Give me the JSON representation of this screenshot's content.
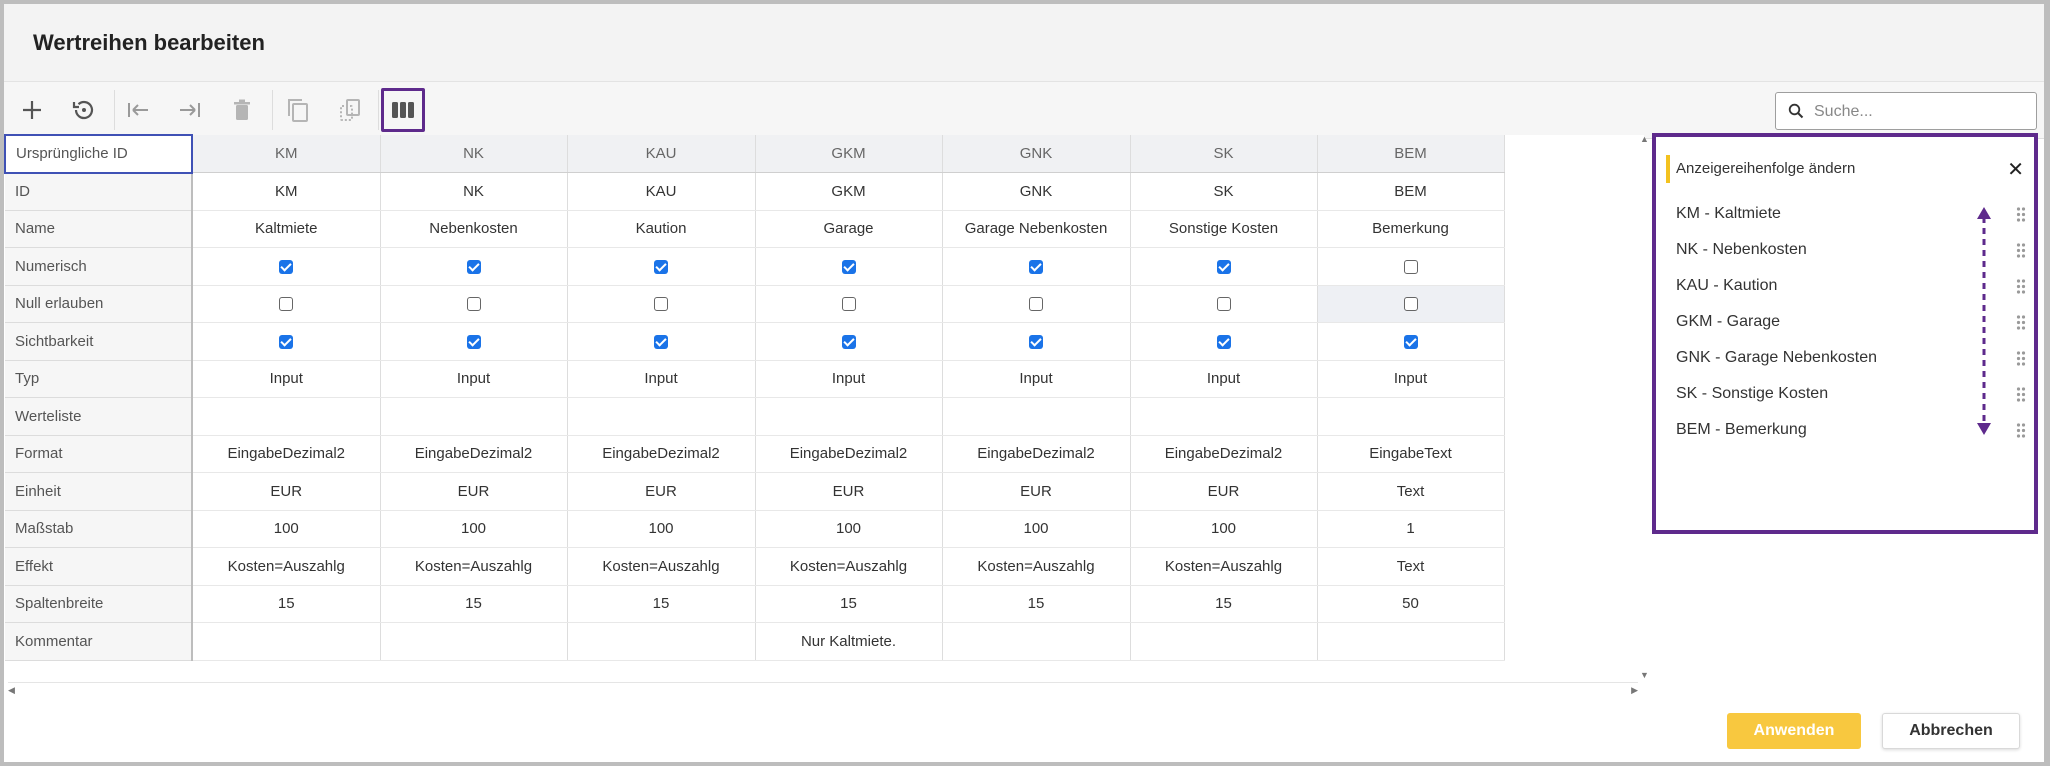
{
  "dialog": {
    "title": "Wertreihen bearbeiten"
  },
  "toolbar": {
    "search_placeholder": "Suche...",
    "icons": [
      "plus-icon",
      "history-icon",
      "move-first-icon",
      "move-last-icon",
      "delete-icon",
      "copy-icon",
      "paste-icon",
      "columns-icon"
    ]
  },
  "grid": {
    "corner_label": "Ursprüngliche ID",
    "columns": [
      "KM",
      "NK",
      "KAU",
      "GKM",
      "GNK",
      "SK",
      "BEM"
    ],
    "rows": [
      {
        "label": "ID",
        "type": "text",
        "values": [
          "KM",
          "NK",
          "KAU",
          "GKM",
          "GNK",
          "SK",
          "BEM"
        ]
      },
      {
        "label": "Name",
        "type": "text",
        "values": [
          "Kaltmiete",
          "Nebenkosten",
          "Kaution",
          "Garage",
          "Garage Nebenkosten",
          "Sonstige Kosten",
          "Bemerkung"
        ]
      },
      {
        "label": "Numerisch",
        "type": "checkbox",
        "values": [
          true,
          true,
          true,
          true,
          true,
          true,
          false
        ]
      },
      {
        "label": "Null erlauben",
        "type": "checkbox",
        "values": [
          false,
          false,
          false,
          false,
          false,
          false,
          false
        ]
      },
      {
        "label": "Sichtbarkeit",
        "type": "checkbox",
        "values": [
          true,
          true,
          true,
          true,
          true,
          true,
          true
        ]
      },
      {
        "label": "Typ",
        "type": "text",
        "values": [
          "Input",
          "Input",
          "Input",
          "Input",
          "Input",
          "Input",
          "Input"
        ]
      },
      {
        "label": "Werteliste",
        "type": "text",
        "values": [
          "",
          "",
          "",
          "",
          "",
          "",
          ""
        ]
      },
      {
        "label": "Format",
        "type": "text",
        "values": [
          "EingabeDezimal2",
          "EingabeDezimal2",
          "EingabeDezimal2",
          "EingabeDezimal2",
          "EingabeDezimal2",
          "EingabeDezimal2",
          "EingabeText"
        ]
      },
      {
        "label": "Einheit",
        "type": "text",
        "values": [
          "EUR",
          "EUR",
          "EUR",
          "EUR",
          "EUR",
          "EUR",
          "Text"
        ]
      },
      {
        "label": "Maßstab",
        "type": "text",
        "values": [
          "100",
          "100",
          "100",
          "100",
          "100",
          "100",
          "1"
        ]
      },
      {
        "label": "Effekt",
        "type": "text",
        "values": [
          "Kosten=Auszahlg",
          "Kosten=Auszahlg",
          "Kosten=Auszahlg",
          "Kosten=Auszahlg",
          "Kosten=Auszahlg",
          "Kosten=Auszahlg",
          "Text"
        ]
      },
      {
        "label": "Spaltenbreite",
        "type": "text",
        "values": [
          "15",
          "15",
          "15",
          "15",
          "15",
          "15",
          "50"
        ]
      },
      {
        "label": "Kommentar",
        "type": "text",
        "values": [
          "",
          "",
          "",
          "Nur Kaltmiete.",
          "",
          "",
          ""
        ]
      }
    ]
  },
  "order_panel": {
    "title": "Anzeigereihenfolge ändern",
    "items": [
      "KM - Kaltmiete",
      "NK - Nebenkosten",
      "KAU - Kaution",
      "GKM - Garage",
      "GNK - Garage Nebenkosten",
      "SK - Sonstige Kosten",
      "BEM - Bemerkung"
    ]
  },
  "footer": {
    "apply_label": "Anwenden",
    "cancel_label": "Abbrechen"
  },
  "colors": {
    "accent": "#5e2a8c",
    "apply": "#f8c83f",
    "checkbox": "#1a73e8",
    "header_marker": "#f3c21f"
  }
}
